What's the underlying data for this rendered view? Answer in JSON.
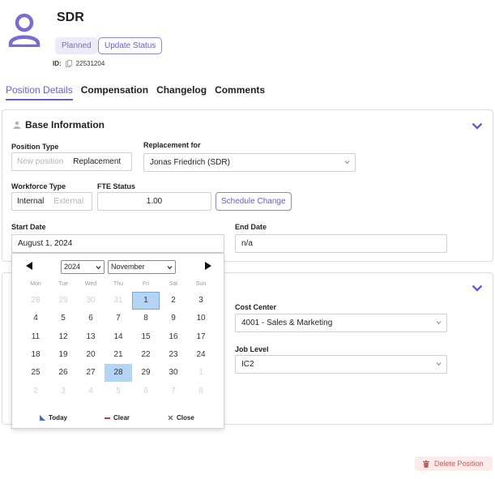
{
  "header": {
    "title": "SDR",
    "status_badge": "Planned",
    "update_status_label": "Update Status",
    "id_label": "ID:",
    "id_value": "22531204"
  },
  "tabs": [
    {
      "label": "Position Details",
      "active": true
    },
    {
      "label": "Compensation",
      "active": false
    },
    {
      "label": "Changelog",
      "active": false
    },
    {
      "label": "Comments",
      "active": false
    }
  ],
  "base_info": {
    "title": "Base Information",
    "position_type": {
      "label": "Position Type",
      "options": [
        "New position",
        "Replacement"
      ],
      "selected": "Replacement"
    },
    "replacement_for": {
      "label": "Replacement for",
      "value": "Jonas Friedrich (SDR)"
    },
    "workforce_type": {
      "label": "Workforce Type",
      "options": [
        "Internal",
        "External"
      ],
      "selected": "Internal"
    },
    "fte_status": {
      "label": "FTE Status",
      "value": "1.00"
    },
    "schedule_change_label": "Schedule Change",
    "start_date": {
      "label": "Start Date",
      "value": "August 1, 2024"
    },
    "end_date": {
      "label": "End Date",
      "value": "n/a"
    }
  },
  "org_info": {
    "cost_center": {
      "label": "Cost Center",
      "value": "4001 - Sales & Marketing"
    },
    "job_level": {
      "label": "Job Level",
      "value": "IC2"
    }
  },
  "calendar": {
    "year": "2024",
    "month": "November",
    "weekdays": [
      "Mon",
      "Tue",
      "Wed",
      "Thu",
      "Fri",
      "Sat",
      "Sun"
    ],
    "weeks": [
      [
        "28",
        "29",
        "30",
        "31",
        "1",
        "2",
        "3"
      ],
      [
        "4",
        "5",
        "6",
        "7",
        "8",
        "9",
        "10"
      ],
      [
        "11",
        "12",
        "13",
        "14",
        "15",
        "16",
        "17"
      ],
      [
        "18",
        "19",
        "20",
        "21",
        "22",
        "23",
        "24"
      ],
      [
        "25",
        "26",
        "27",
        "28",
        "29",
        "30",
        "1"
      ],
      [
        "2",
        "3",
        "4",
        "5",
        "6",
        "7",
        "8"
      ]
    ],
    "today_label": "Today",
    "clear_label": "Clear",
    "close_label": "Close"
  },
  "delete_label": "Delete Position",
  "colors": {
    "accent": "#6b5cc7",
    "danger": "#c95a5a",
    "selected_day": "#b3d4f5"
  }
}
